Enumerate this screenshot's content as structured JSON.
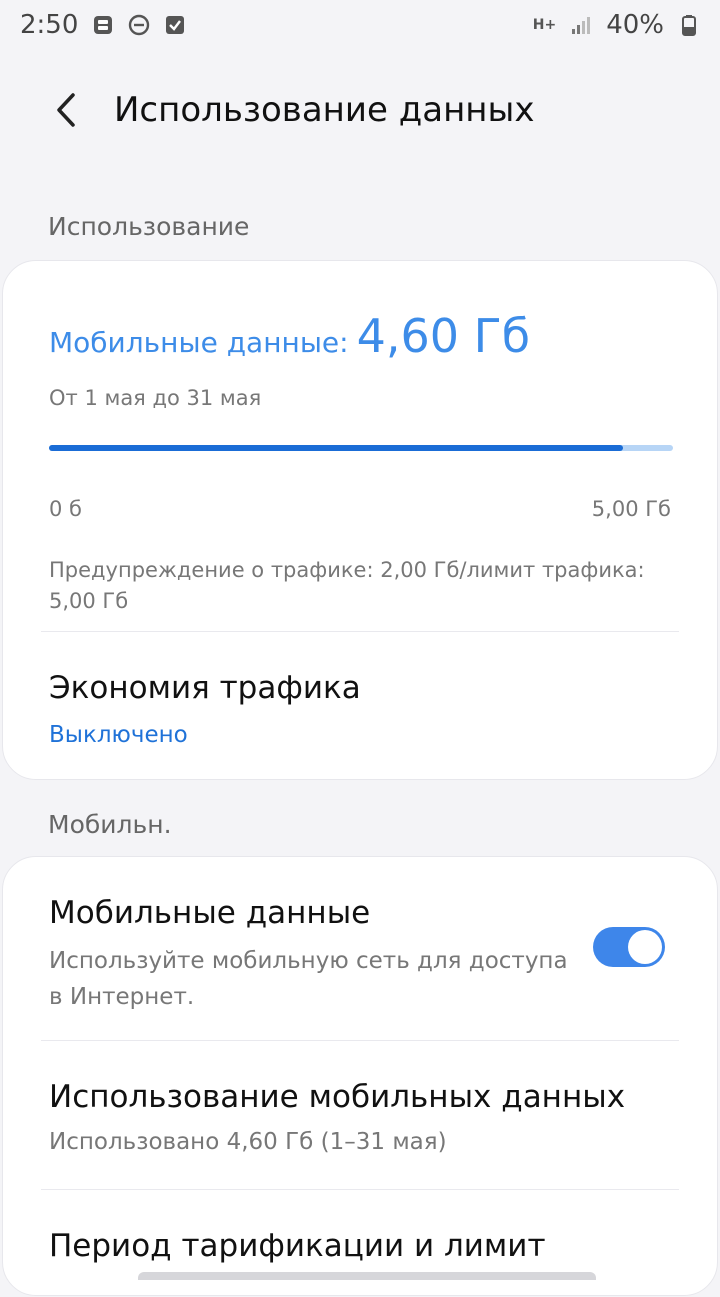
{
  "status_bar": {
    "time": "2:50",
    "network": "H+",
    "battery": "40%"
  },
  "header": {
    "title": "Использование данных"
  },
  "usage_section": {
    "header": "Использование",
    "label": "Мобильные данные:",
    "value": "4,60 Гб",
    "period": "От 1 мая до 31 мая",
    "progress_fraction": 0.92,
    "scale_min": "0 б",
    "scale_max": "5,00 Гб",
    "warning": "Предупреждение о трафике: 2,00 Гб/лимит трафика: 5,00 Гб",
    "data_saver": {
      "title": "Экономия трафика",
      "status": "Выключено"
    }
  },
  "mobile_section": {
    "header": "Мобильн.",
    "mobile_data": {
      "title": "Мобильные данные",
      "subtitle": "Используйте мобильную сеть для доступа в Интернет.",
      "enabled": true
    },
    "mobile_usage": {
      "title": "Использование мобильных данных",
      "subtitle": "Использовано 4,60 Гб (1–31 мая)"
    },
    "billing": {
      "title": "Период тарификации и лимит"
    }
  },
  "colors": {
    "accent": "#3d8ce8",
    "progress": "#1a6cd6",
    "link": "#1f72d8"
  }
}
